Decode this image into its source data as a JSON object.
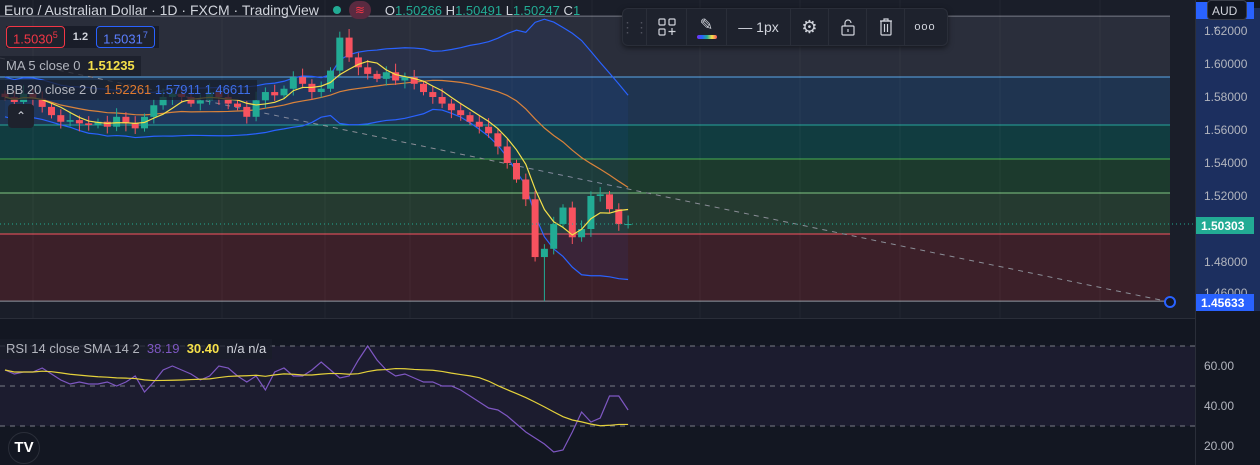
{
  "header": {
    "symbol": "Euro / Australian Dollar",
    "interval": "1D",
    "exchange": "FXCM",
    "source": "TradingView",
    "open_label": "O",
    "open": "1.50266",
    "high_label": "H",
    "high": "1.50491",
    "low_label": "L",
    "low": "1.50247",
    "close_label": "C",
    "close": "1"
  },
  "trade": {
    "sell_main": "1.5030",
    "sell_sup": "5",
    "spread": "1.2",
    "buy_main": "1.5031",
    "buy_sup": "7"
  },
  "legends": {
    "ma": {
      "label": "MA 5 close 0",
      "value": "1.51235"
    },
    "bb": {
      "label": "BB 20 close 2 0",
      "basis": "1.52261",
      "upper": "1.57911",
      "lower": "1.46611"
    },
    "rsi": {
      "label": "RSI 14 close SMA 14 2",
      "rsi": "38.19",
      "sma": "30.40",
      "na1": "n/a",
      "na2": "n/a"
    }
  },
  "toolbar": {
    "width_label": "1px"
  },
  "axis": {
    "currency": "AUD",
    "ticks": [
      "1.62000",
      "1.60000",
      "1.58000",
      "1.56000",
      "1.54000",
      "1.52000",
      "1.48000",
      "1.46000"
    ],
    "current_price": "1.50303",
    "drawing_price": "1.45633",
    "rsi_ticks": [
      "60.00",
      "40.00",
      "20.00"
    ]
  },
  "colors": {
    "up": "#22ab94",
    "down": "#f7525f",
    "ma": "#f5e04a",
    "bb_basis": "#d9823b",
    "bb_band": "#2962ff",
    "rsi": "#7e57c2",
    "rsi_sma": "#e4d13b"
  },
  "chart_data": {
    "type": "candlestick",
    "price_range": [
      1.445,
      1.638
    ],
    "closes": [
      1.58,
      1.577,
      1.582,
      1.579,
      1.574,
      1.569,
      1.565,
      1.566,
      1.564,
      1.563,
      1.565,
      1.562,
      1.568,
      1.564,
      1.561,
      1.568,
      1.575,
      1.58,
      1.582,
      1.58,
      1.576,
      1.578,
      1.583,
      1.58,
      1.576,
      1.574,
      1.568,
      1.578,
      1.583,
      1.581,
      1.585,
      1.592,
      1.588,
      1.583,
      1.585,
      1.596,
      1.616,
      1.604,
      1.598,
      1.594,
      1.591,
      1.595,
      1.59,
      1.592,
      1.588,
      1.583,
      1.58,
      1.576,
      1.572,
      1.569,
      1.565,
      1.562,
      1.558,
      1.55,
      1.54,
      1.53,
      1.518,
      1.483,
      1.488,
      1.503,
      1.513,
      1.495,
      1.5,
      1.52,
      1.521,
      1.512,
      1.503,
      1.503
    ],
    "ma_period": 5,
    "bb_period": 20,
    "bb_mult": 2,
    "fib_levels": [
      1.629,
      1.5921,
      1.563,
      1.5424,
      1.5218,
      1.497,
      1.4563
    ],
    "rsi": [
      58,
      56,
      57,
      57,
      59,
      56,
      53,
      51,
      52,
      51,
      51,
      52,
      50,
      52,
      55,
      47,
      52,
      58,
      60,
      58,
      56,
      53,
      55,
      60,
      59,
      55,
      52,
      55,
      48,
      57,
      59,
      55,
      55,
      58,
      62,
      58,
      54,
      55,
      63,
      70,
      63,
      58,
      55,
      56,
      54,
      52,
      52,
      50,
      50,
      48,
      45,
      42,
      39,
      38,
      35,
      31,
      27,
      24,
      21,
      17,
      18,
      27,
      37,
      32,
      34,
      45,
      45,
      38
    ],
    "rsi_sma_period": 14,
    "rsi_range": [
      10,
      80
    ],
    "rsi_bands": [
      70,
      50,
      30
    ]
  }
}
